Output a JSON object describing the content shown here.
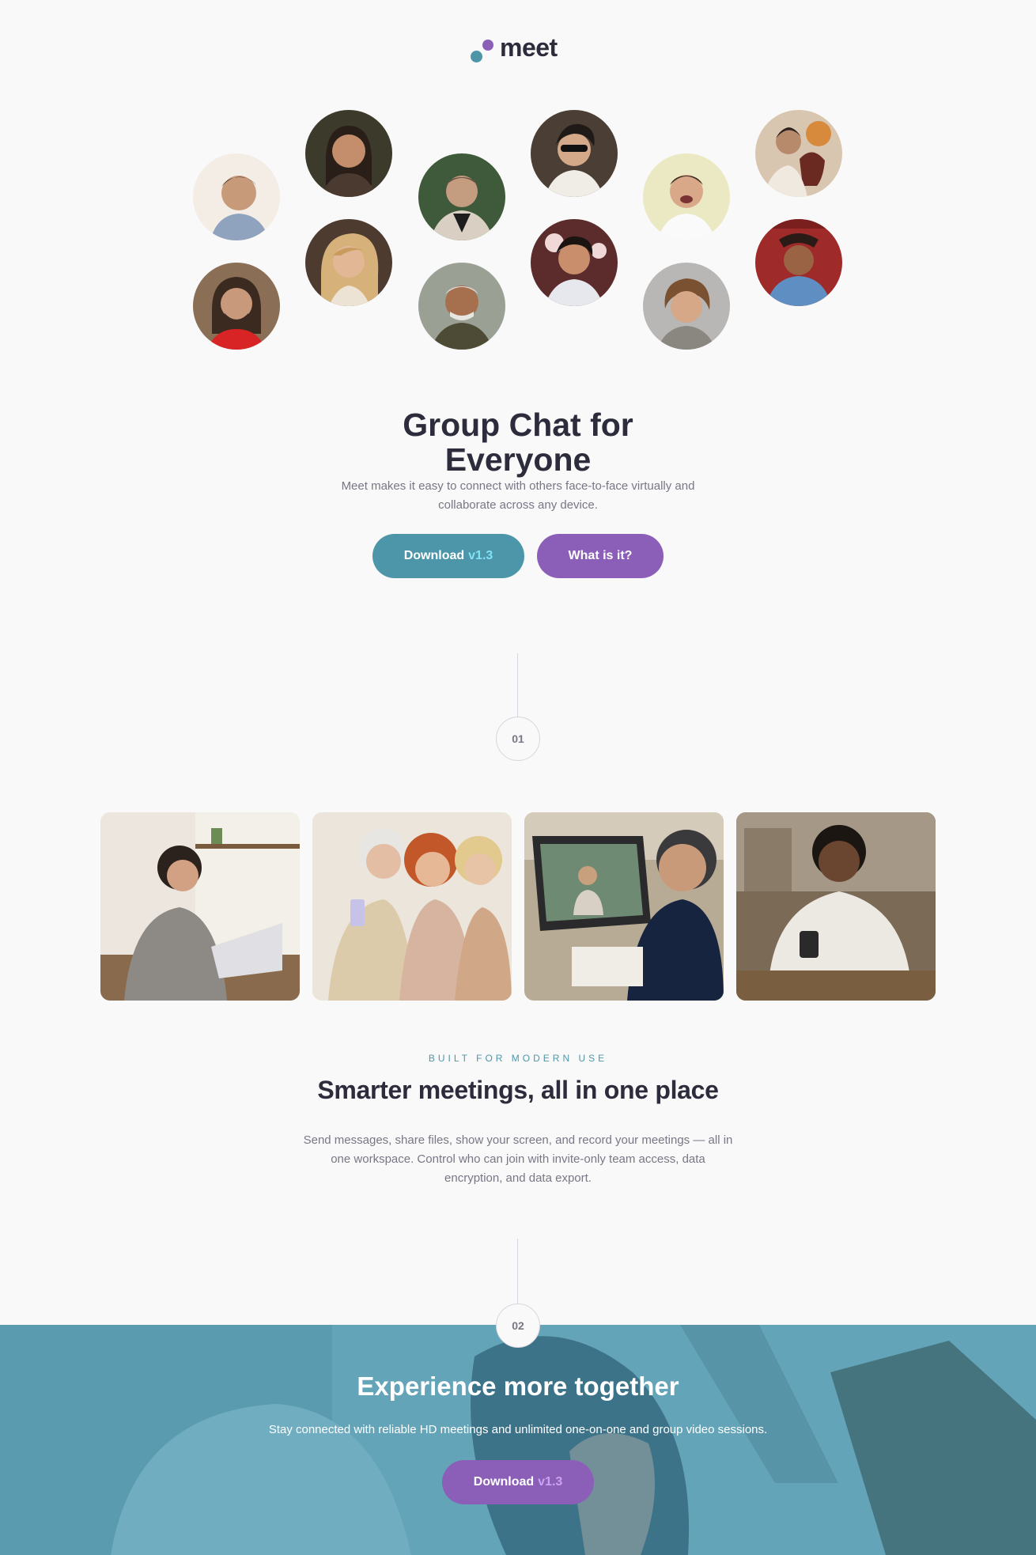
{
  "brand": {
    "name": "meet",
    "icon": "meet-logo-dots"
  },
  "colors": {
    "teal": "#4d96a9",
    "purple": "#8b5fb8",
    "ink": "#2d2c3c",
    "muted": "#777786",
    "background": "#f9f9f9"
  },
  "hero": {
    "title_line1": "Group Chat for",
    "title_line2": "Everyone",
    "description": "Meet makes it easy to connect with others face-to-face virtually and collaborate across any device.",
    "download_label": "Download",
    "download_version": "v1.3",
    "what_label": "What is it?"
  },
  "avatars": [
    "avatar-1",
    "avatar-2",
    "avatar-3",
    "avatar-4",
    "avatar-5",
    "avatar-6",
    "avatar-7",
    "avatar-8",
    "avatar-9",
    "avatar-10",
    "avatar-11",
    "avatar-12"
  ],
  "step1": {
    "number": "01"
  },
  "photos": [
    "photo-woman-laptop",
    "photo-women-phone",
    "photo-man-videocall",
    "photo-man-phone"
  ],
  "features": {
    "eyebrow": "BUILT FOR MODERN USE",
    "title": "Smarter meetings, all in one place",
    "description": "Send messages, share files, show your screen, and record your meetings — all in one workspace. Control who can join with invite-only team access, data encryption, and data export."
  },
  "step2": {
    "number": "02"
  },
  "cta": {
    "title": "Experience more together",
    "description": "Stay connected with reliable HD meetings and unlimited one-on-one and group video sessions.",
    "download_label": "Download",
    "download_version": "v1.3"
  }
}
